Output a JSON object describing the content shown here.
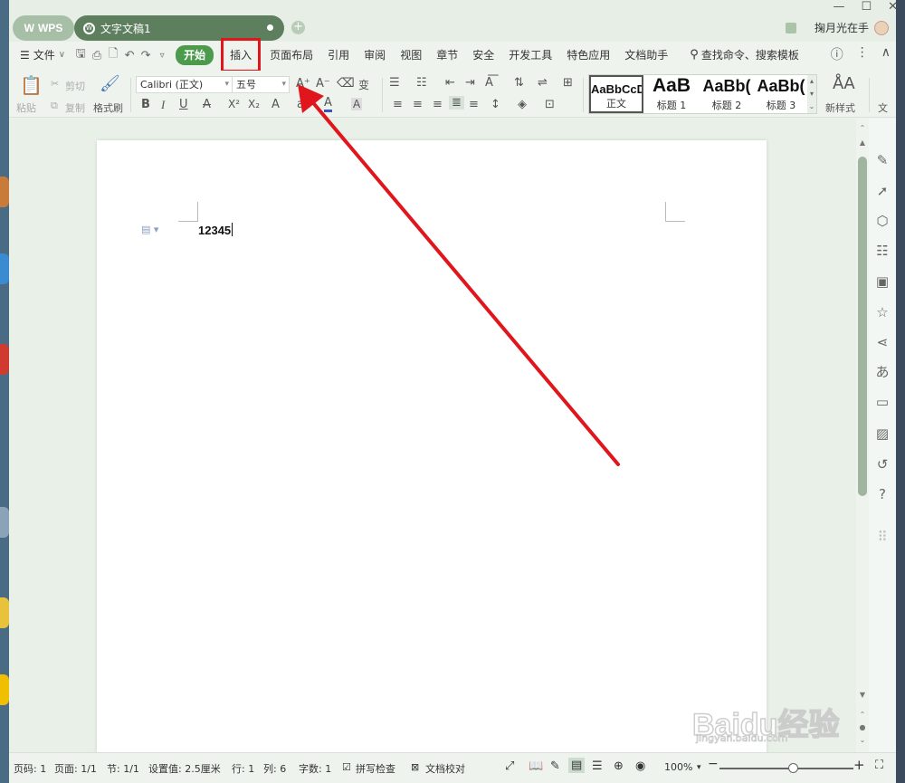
{
  "titlebar": {
    "wps_label": "WPS",
    "doc_tab": "文字文稿1",
    "user_name": "掬月光在手",
    "controls": [
      "—",
      "☐",
      "✕"
    ]
  },
  "menu": {
    "file": "文件",
    "tabs": [
      "开始",
      "插入",
      "页面布局",
      "引用",
      "审阅",
      "视图",
      "章节",
      "安全",
      "开发工具",
      "特色应用",
      "文档助手"
    ],
    "search": "查找命令、搜索模板"
  },
  "ribbon": {
    "paste": "粘贴",
    "cut": "剪切",
    "copy": "复制",
    "format_painter": "格式刷",
    "font_name": "Calibri (正文)",
    "font_size": "五号",
    "styles": [
      {
        "sample": "AaBbCcDd",
        "label": "正文"
      },
      {
        "sample": "AaB",
        "label": "标题 1"
      },
      {
        "sample": "AaBb(",
        "label": "标题 2"
      },
      {
        "sample": "AaBb(",
        "label": "标题 3"
      }
    ],
    "new_style": "新样式",
    "text_tools": "文"
  },
  "document": {
    "text": "12345"
  },
  "status": {
    "page": "页码: 1",
    "pages": "页面: 1/1",
    "section": "节: 1/1",
    "setting": "设置值: 2.5厘米",
    "row": "行: 1",
    "col": "列: 6",
    "words": "字数: 1",
    "spell": "拼写检查",
    "proof": "文档校对",
    "zoom": "100%"
  },
  "zoom_level": 0.55,
  "watermark": {
    "logo": "Baidu经验",
    "url": "jingyan.baidu.com"
  },
  "colors": {
    "accent": "#4c9b4c",
    "highlight_box": "#e0161c",
    "arrow": "#e0161c"
  }
}
